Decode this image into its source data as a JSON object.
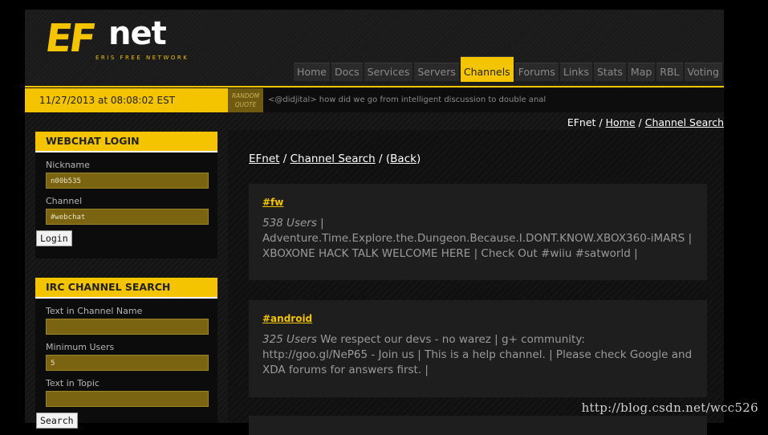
{
  "logo": {
    "ef": "EF",
    "net": "net",
    "subtitle": "ERIS FREE NETWORK"
  },
  "nav": [
    "Home",
    "Docs",
    "Services",
    "Servers",
    "Channels",
    "Forums",
    "Links",
    "Stats",
    "Map",
    "RBL",
    "Voting"
  ],
  "nav_active": "Channels",
  "ticker": {
    "datetime": "11/27/2013 at 08:08:02 EST",
    "quote_tag": "RANDOM QUOTE",
    "quote": "<@didjital> how did we go from intelligent discussion to double anal"
  },
  "top_breadcrumb": {
    "root": "EFnet",
    "sep": "/",
    "home": "Home",
    "current": "Channel Search"
  },
  "webchat": {
    "title": "WEBCHAT LOGIN",
    "nickname_label": "Nickname",
    "nickname_value": "n00b535",
    "channel_label": "Channel",
    "channel_value": "#webchat",
    "login_button": "Login"
  },
  "search": {
    "title": "IRC CHANNEL SEARCH",
    "name_label": "Text in Channel Name",
    "min_users_label": "Minimum Users",
    "min_users_value": "5",
    "topic_label": "Text in Topic",
    "search_button": "Search"
  },
  "main_breadcrumb": {
    "root": "EFnet",
    "sep": "/",
    "search": "Channel Search",
    "back": "Back"
  },
  "channels": [
    {
      "name": "#fw",
      "users": "538 Users",
      "topic": "Adventure.Time.Explore.the.Dungeon.Because.I.DONT.KNOW.XBOX360-iMARS | XBOXONE HACK TALK WELCOME HERE | Check Out #wiiu #satworld |"
    },
    {
      "name": "#android",
      "users": "325 Users",
      "topic": "We respect our devs - no warez | g+ community: http://goo.gl/NeP65 - Join us | This is a help channel. | Please check Google and XDA forums for answers first. |"
    }
  ],
  "watermark": "http://blog.csdn.net/wcc526"
}
